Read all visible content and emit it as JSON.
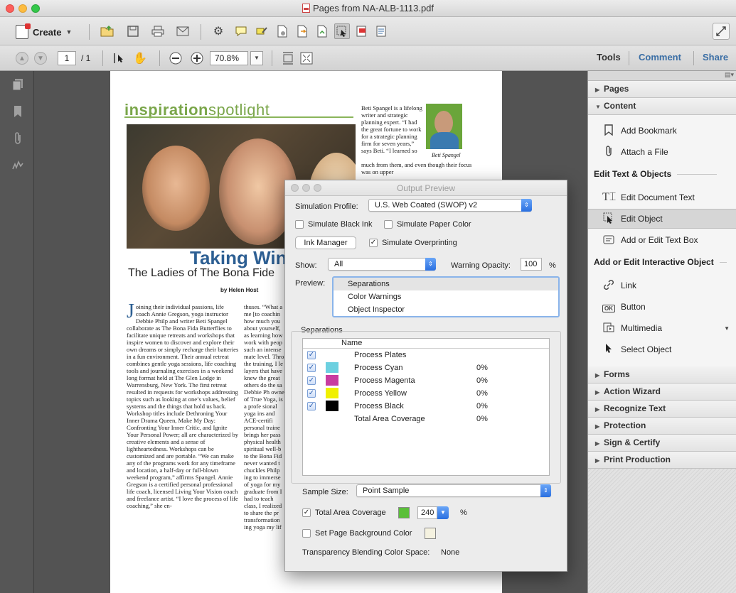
{
  "window": {
    "title": "Pages from NA-ALB-1113.pdf"
  },
  "toolbar": {
    "create_label": "Create",
    "page_current": "1",
    "page_total": "/ 1",
    "zoom": "70.8%",
    "tabs": {
      "tools": "Tools",
      "comment": "Comment",
      "share": "Share"
    }
  },
  "document": {
    "section_bold": "inspiration",
    "section_light": "spotlight",
    "headline": "Taking Win",
    "subhead": "The Ladies of The Bona Fide",
    "byline": "by Helen Host",
    "bio_caption": "Beti Spangel",
    "bio_top": "Beti Spangel is a lifelong writer and strategic planning expert. “I had the great fortune to work for a strategic planning firm for seven years,” says Beti. “I learned so",
    "bio_bottom": "much from them, and even though their focus was on upper",
    "col1_dropcap": "J",
    "col1": "oining their individual passions, life coach Annie Gregson, yoga instructor Debbie Philp and writer Beti Spangel collaborate as The Bona Fida Butterflies to facilitate unique retreats and workshops that inspire women to discover and explore their own dreams or simply recharge their batteries in a fun environment. Their annual retreat combines gentle yoga sessions, life coaching tools and journaling exercises in a weekend long format held at The Glen Lodge in Warrensburg, New York. The first retreat resulted in requests for workshops addressing topics such as looking at one’s values, belief systems and the things that hold us back. Workshop titles include Dethroning Your Inner Drama Queen, Make My Day: Confronting Your Inner Critic, and Ignite Your Personal Power; all are characterized by creative elements and a sense of lightheartedness. Workshops can be customized and are portable. “We can make any of the programs work for any timeframe and location, a half-day or full-blown weekend program,” affirms Spangel. Annie Gregson is a certified personal professional life coach, licensed Living Your Vision coach and freelance artist. “I love the process of life coaching,” she en-",
    "col2": "thuses. “What a me [to coachin how much you about yourself, as learning how work with peop such an intense mate level. Thro the training, I le layers that have knew the great others do the sa Debbie Ph owner of True Yoga, is a profe sional yoga ins and ACE-certifi personal traine brings her pass physical health spiritual well-b to the Bona Fid never wanted t chuckles Philp ing to immerse of yoga for my graduate from I had to teach class, I realized to share the pr transformation ing yoga my lif"
  },
  "output_preview": {
    "title": "Output Preview",
    "simulation_profile_label": "Simulation Profile:",
    "simulation_profile_value": "U.S. Web Coated (SWOP) v2",
    "simulate_black_ink": "Simulate Black Ink",
    "simulate_paper_color": "Simulate Paper Color",
    "ink_manager": "Ink Manager",
    "simulate_overprinting": "Simulate Overprinting",
    "show_label": "Show:",
    "show_value": "All",
    "warning_opacity_label": "Warning Opacity:",
    "warning_opacity_value": "100",
    "percent": "%",
    "preview_label": "Preview:",
    "preview_options": [
      "Separations",
      "Color Warnings",
      "Object Inspector"
    ],
    "separations_label": "Separations",
    "name_header": "Name",
    "separations": [
      {
        "name": "Process Plates",
        "value": "",
        "swatch": ""
      },
      {
        "name": "Process Cyan",
        "value": "0%",
        "swatch": "#6cd0e0"
      },
      {
        "name": "Process Magenta",
        "value": "0%",
        "swatch": "#c83ca0"
      },
      {
        "name": "Process Yellow",
        "value": "0%",
        "swatch": "#f0f000"
      },
      {
        "name": "Process Black",
        "value": "0%",
        "swatch": "#000000"
      },
      {
        "name": "Total Area Coverage",
        "value": "0%",
        "swatch": ""
      }
    ],
    "sample_size_label": "Sample Size:",
    "sample_size_value": "Point Sample",
    "total_area_coverage": "Total Area Coverage",
    "tac_value": "240",
    "set_page_bg": "Set Page Background Color",
    "transparency_label": "Transparency Blending Color Space:",
    "transparency_value": "None"
  },
  "right_panel": {
    "pages": "Pages",
    "content": "Content",
    "add_bookmark": "Add Bookmark",
    "attach_file": "Attach a File",
    "edit_text_objects": "Edit Text & Objects",
    "edit_document_text": "Edit Document Text",
    "edit_object": "Edit Object",
    "add_edit_text_box": "Add or Edit Text Box",
    "add_edit_interactive": "Add or Edit Interactive Object",
    "link": "Link",
    "button": "Button",
    "multimedia": "Multimedia",
    "select_object": "Select Object",
    "sections": [
      "Forms",
      "Action Wizard",
      "Recognize Text",
      "Protection",
      "Sign & Certify",
      "Print Production"
    ]
  }
}
